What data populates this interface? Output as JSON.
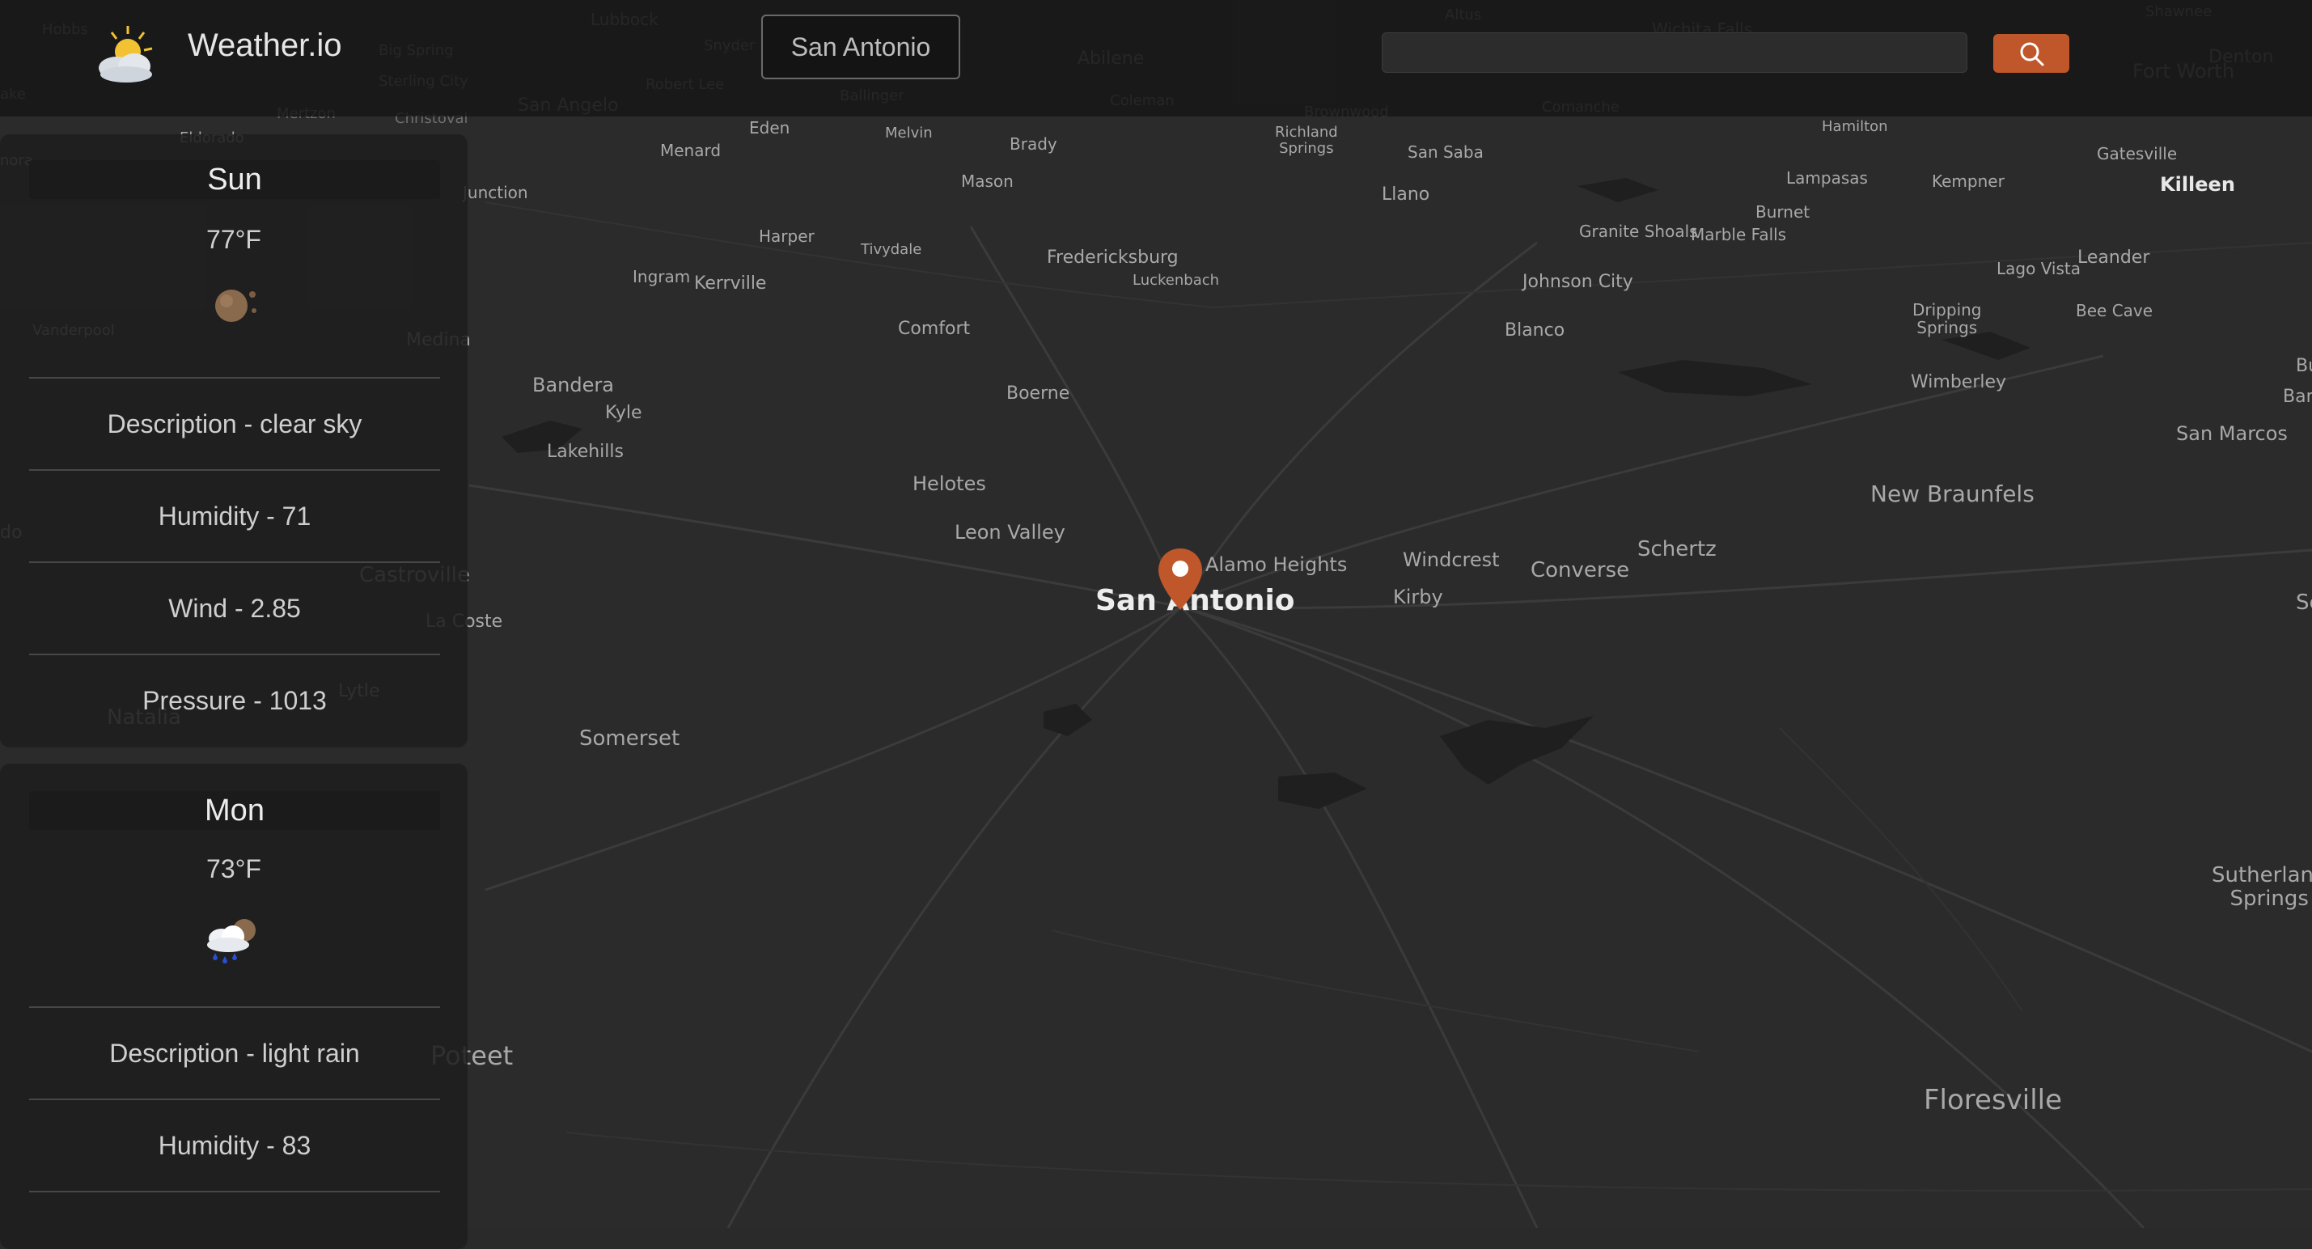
{
  "header": {
    "app_title": "Weather.io",
    "city_button": "San Antonio",
    "search_placeholder": "",
    "search_value": ""
  },
  "forecast": [
    {
      "day": "Sun",
      "temp": "77°F",
      "icon": "sun-icon",
      "description": "Description - clear sky",
      "humidity": "Humidity - 71",
      "wind": "Wind - 2.85",
      "pressure": "Pressure - 1013"
    },
    {
      "day": "Mon",
      "temp": "73°F",
      "icon": "rain-cloud-icon",
      "description": "Description - light rain",
      "humidity": "Humidity - 83"
    }
  ],
  "map": {
    "center_city": "San Antonio",
    "accent_color": "#c0572b",
    "labels": [
      {
        "text": "Hobbs",
        "tone": "dim"
      },
      {
        "text": "Lubbock",
        "tone": "dim"
      },
      {
        "text": "Snyder",
        "tone": "dim"
      },
      {
        "text": "Big Spring",
        "tone": "dim"
      },
      {
        "text": "Sterling City",
        "tone": "dim"
      },
      {
        "text": "Robert Lee",
        "tone": "dim"
      },
      {
        "text": "Mertzon",
        "tone": "dim"
      },
      {
        "text": "Christoval",
        "tone": "dim"
      },
      {
        "text": "San Angelo",
        "tone": "dim"
      },
      {
        "text": "Ballinger",
        "tone": "dim"
      },
      {
        "text": "Abilene",
        "tone": "dim"
      },
      {
        "text": "Coleman",
        "tone": "dim"
      },
      {
        "text": "Altus",
        "tone": "dim"
      },
      {
        "text": "Wichita Falls",
        "tone": "dim"
      },
      {
        "text": "Shawnee",
        "tone": "dim"
      },
      {
        "text": "Fort Worth",
        "tone": "dim"
      },
      {
        "text": "Denton",
        "tone": "dim"
      },
      {
        "text": "Brownwood",
        "tone": "dim"
      },
      {
        "text": "Comanche",
        "tone": "dim"
      },
      {
        "text": "Eldorado",
        "tone": "mid"
      },
      {
        "text": "Eden",
        "tone": "mid"
      },
      {
        "text": "Melvin",
        "tone": "mid"
      },
      {
        "text": "Brady",
        "tone": "mid"
      },
      {
        "text": "Richland Springs",
        "tone": "mid"
      },
      {
        "text": "San Saba",
        "tone": "mid"
      },
      {
        "text": "Hamilton",
        "tone": "mid"
      },
      {
        "text": "Menard",
        "tone": "mid"
      },
      {
        "text": "Mason",
        "tone": "mid"
      },
      {
        "text": "Llano",
        "tone": "mid"
      },
      {
        "text": "Lampasas",
        "tone": "mid"
      },
      {
        "text": "Kempner",
        "tone": "mid"
      },
      {
        "text": "Gatesville",
        "tone": "mid"
      },
      {
        "text": "Killeen",
        "tone": "bright"
      },
      {
        "text": "Junction",
        "tone": "mid"
      },
      {
        "text": "Burnet",
        "tone": "mid"
      },
      {
        "text": "Granite Shoals",
        "tone": "mid"
      },
      {
        "text": "Marble Falls",
        "tone": "mid"
      },
      {
        "text": "Harper",
        "tone": "mid"
      },
      {
        "text": "Tivydale",
        "tone": "mid"
      },
      {
        "text": "Fredericksburg",
        "tone": "mid"
      },
      {
        "text": "Luckenbach",
        "tone": "mid"
      },
      {
        "text": "Lago Vista",
        "tone": "mid"
      },
      {
        "text": "Leander",
        "tone": "mid"
      },
      {
        "text": "Ingram",
        "tone": "mid"
      },
      {
        "text": "Kerrville",
        "tone": "mid"
      },
      {
        "text": "Johnson City",
        "tone": "mid"
      },
      {
        "text": "Bee Cave",
        "tone": "mid"
      },
      {
        "text": "Comfort",
        "tone": "mid"
      },
      {
        "text": "Blanco",
        "tone": "mid"
      },
      {
        "text": "Dripping Springs",
        "tone": "mid"
      },
      {
        "text": "Vanderpool",
        "tone": "mid"
      },
      {
        "text": "Medina",
        "tone": "mid"
      },
      {
        "text": "Bandera",
        "tone": "mid"
      },
      {
        "text": "Boerne",
        "tone": "mid"
      },
      {
        "text": "Wimberley",
        "tone": "mid"
      },
      {
        "text": "Bu",
        "tone": "mid"
      },
      {
        "text": "Kyle",
        "tone": "mid"
      },
      {
        "text": "Bandera Falls",
        "tone": "mid"
      },
      {
        "text": "San Marcos",
        "tone": "mid"
      },
      {
        "text": "Lakehills",
        "tone": "mid"
      },
      {
        "text": "Helotes",
        "tone": "mid"
      },
      {
        "text": "New Braunfels",
        "tone": "mid"
      },
      {
        "text": "Leon Valley",
        "tone": "mid"
      },
      {
        "text": "Alamo Heights",
        "tone": "mid"
      },
      {
        "text": "Windcrest",
        "tone": "mid"
      },
      {
        "text": "Schertz",
        "tone": "mid"
      },
      {
        "text": "Converse",
        "tone": "mid"
      },
      {
        "text": "Castroville",
        "tone": "mid"
      },
      {
        "text": "Kirby",
        "tone": "mid"
      },
      {
        "text": "Se",
        "tone": "mid"
      },
      {
        "text": "La Coste",
        "tone": "mid"
      },
      {
        "text": "Lytle",
        "tone": "mid"
      },
      {
        "text": "Natalia",
        "tone": "mid"
      },
      {
        "text": "Somerset",
        "tone": "mid"
      },
      {
        "text": "Sutherland Springs",
        "tone": "mid"
      },
      {
        "text": "Poteet",
        "tone": "mid"
      },
      {
        "text": "Floresville",
        "tone": "mid"
      },
      {
        "text": "nora",
        "tone": "mid"
      },
      {
        "text": "ake",
        "tone": "dim"
      },
      {
        "text": "do",
        "tone": "mid"
      }
    ]
  }
}
